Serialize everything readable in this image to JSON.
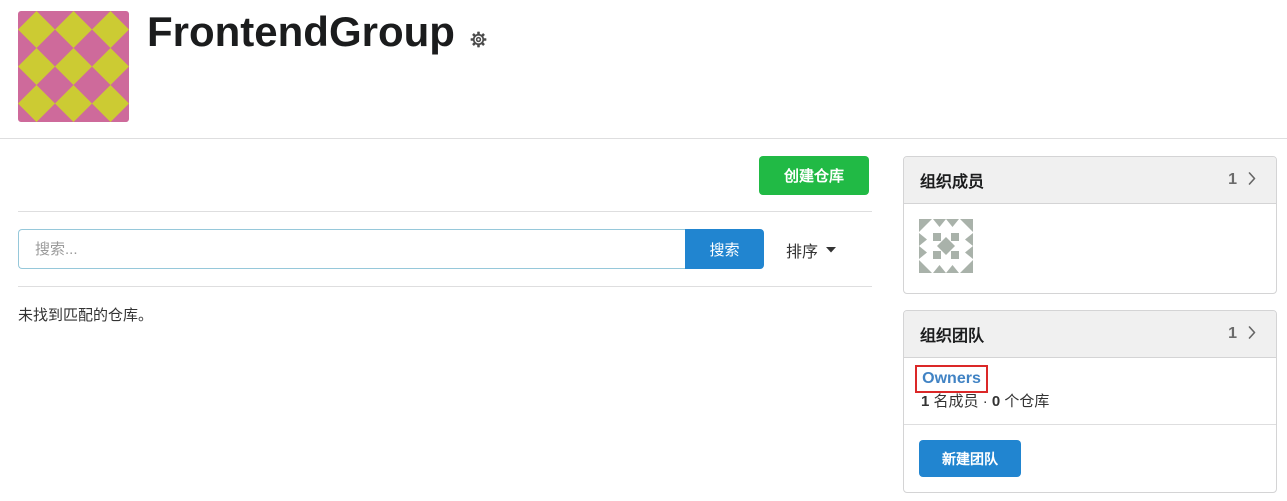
{
  "org": {
    "name": "FrontendGroup",
    "avatar_icon": "org-avatar",
    "settings_icon": "gear-icon"
  },
  "toolbar": {
    "create_repo_label": "创建仓库"
  },
  "search": {
    "placeholder": "搜索...",
    "value": "",
    "button_label": "搜索"
  },
  "sort": {
    "label": "排序",
    "icon": "caret-down-icon"
  },
  "repo_list": {
    "empty_message": "未找到匹配的仓库。"
  },
  "members_card": {
    "title": "组织成员",
    "count": "1",
    "chevron_icon": "chevron-right-icon",
    "members": [
      {
        "avatar_icon": "identicon-avatar"
      }
    ]
  },
  "teams_card": {
    "title": "组织团队",
    "count": "1",
    "chevron_icon": "chevron-right-icon",
    "teams": [
      {
        "name": "Owners",
        "member_count": "1",
        "member_label": "名成员",
        "separator": "·",
        "repo_count": "0",
        "repo_label": "个仓库"
      }
    ],
    "new_team_label": "新建团队"
  },
  "colors": {
    "primary_green": "#21ba45",
    "primary_blue": "#2185d0",
    "link": "#4183c4",
    "highlight_outline": "#db2828",
    "avatar_pink": "#ce6a9b",
    "avatar_yellow": "#cccb33",
    "identicon_gray": "#a9b2aa"
  }
}
